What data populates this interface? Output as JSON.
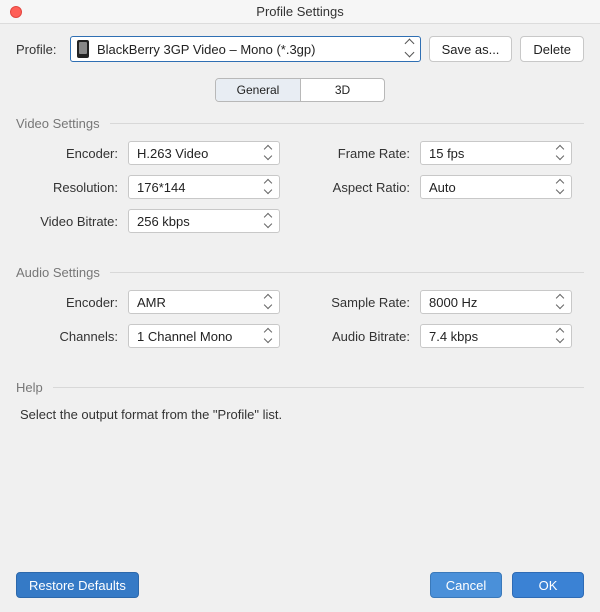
{
  "window": {
    "title": "Profile Settings"
  },
  "profile": {
    "label": "Profile:",
    "value": "BlackBerry 3GP Video – Mono (*.3gp)"
  },
  "buttons": {
    "save_as": "Save as...",
    "delete": "Delete",
    "restore_defaults": "Restore Defaults",
    "cancel": "Cancel",
    "ok": "OK"
  },
  "tabs": {
    "general": "General",
    "three_d": "3D"
  },
  "video": {
    "heading": "Video Settings",
    "encoder_label": "Encoder:",
    "encoder_value": "H.263 Video",
    "resolution_label": "Resolution:",
    "resolution_value": "176*144",
    "video_bitrate_label": "Video Bitrate:",
    "video_bitrate_value": "256 kbps",
    "frame_rate_label": "Frame Rate:",
    "frame_rate_value": "15 fps",
    "aspect_ratio_label": "Aspect Ratio:",
    "aspect_ratio_value": "Auto"
  },
  "audio": {
    "heading": "Audio Settings",
    "encoder_label": "Encoder:",
    "encoder_value": "AMR",
    "channels_label": "Channels:",
    "channels_value": "1 Channel Mono",
    "sample_rate_label": "Sample Rate:",
    "sample_rate_value": "8000 Hz",
    "audio_bitrate_label": "Audio Bitrate:",
    "audio_bitrate_value": "7.4 kbps"
  },
  "help": {
    "heading": "Help",
    "text": "Select the output format from the \"Profile\" list."
  }
}
